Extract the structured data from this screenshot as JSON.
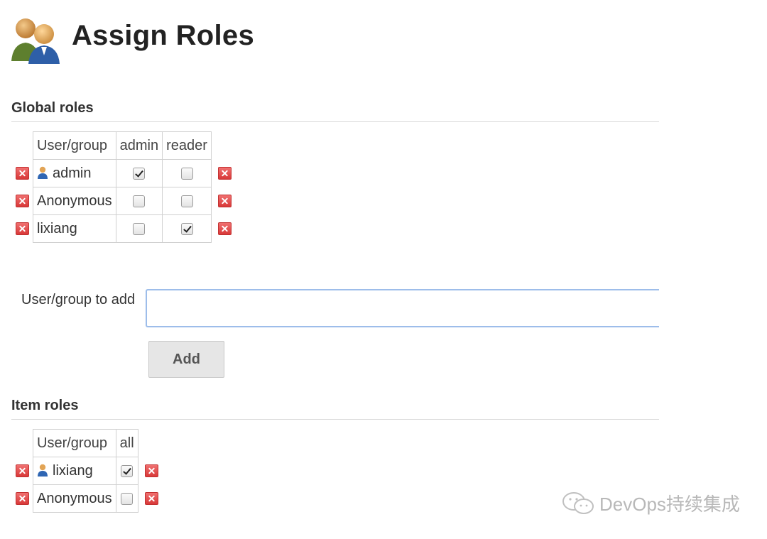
{
  "page": {
    "title": "Assign Roles"
  },
  "global_roles": {
    "heading": "Global roles",
    "columns": [
      "User/group",
      "admin",
      "reader"
    ],
    "rows": [
      {
        "name": "admin",
        "user_icon": "user-icon",
        "checks": [
          true,
          false
        ]
      },
      {
        "name": "Anonymous",
        "user_icon": "",
        "checks": [
          false,
          false
        ]
      },
      {
        "name": "lixiang",
        "user_icon": "",
        "checks": [
          false,
          true
        ]
      }
    ]
  },
  "add_user": {
    "label": "User/group to add",
    "value": "",
    "button": "Add"
  },
  "item_roles": {
    "heading": "Item roles",
    "columns": [
      "User/group",
      "all"
    ],
    "rows": [
      {
        "name": "lixiang",
        "user_icon": "user-icon",
        "checks": [
          true
        ]
      },
      {
        "name": "Anonymous",
        "user_icon": "",
        "checks": [
          false
        ]
      }
    ]
  },
  "watermark": {
    "text": "DevOps持续集成",
    "logo": "wechat-logo"
  },
  "colors": {
    "delete_icon": "#d83838",
    "input_border": "#9dbdea",
    "button_bg": "#e6e6e6"
  }
}
